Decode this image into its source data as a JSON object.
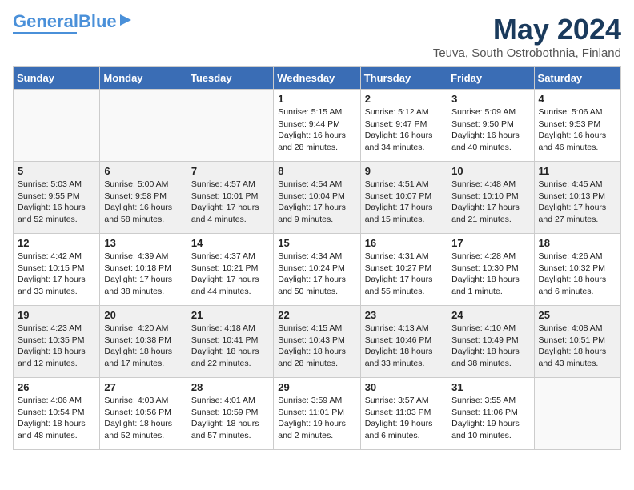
{
  "header": {
    "logo_general": "General",
    "logo_blue": "Blue",
    "month": "May 2024",
    "location": "Teuva, South Ostrobothnia, Finland"
  },
  "days_of_week": [
    "Sunday",
    "Monday",
    "Tuesday",
    "Wednesday",
    "Thursday",
    "Friday",
    "Saturday"
  ],
  "weeks": [
    [
      {
        "num": "",
        "info": ""
      },
      {
        "num": "",
        "info": ""
      },
      {
        "num": "",
        "info": ""
      },
      {
        "num": "1",
        "info": "Sunrise: 5:15 AM\nSunset: 9:44 PM\nDaylight: 16 hours\nand 28 minutes."
      },
      {
        "num": "2",
        "info": "Sunrise: 5:12 AM\nSunset: 9:47 PM\nDaylight: 16 hours\nand 34 minutes."
      },
      {
        "num": "3",
        "info": "Sunrise: 5:09 AM\nSunset: 9:50 PM\nDaylight: 16 hours\nand 40 minutes."
      },
      {
        "num": "4",
        "info": "Sunrise: 5:06 AM\nSunset: 9:53 PM\nDaylight: 16 hours\nand 46 minutes."
      }
    ],
    [
      {
        "num": "5",
        "info": "Sunrise: 5:03 AM\nSunset: 9:55 PM\nDaylight: 16 hours\nand 52 minutes."
      },
      {
        "num": "6",
        "info": "Sunrise: 5:00 AM\nSunset: 9:58 PM\nDaylight: 16 hours\nand 58 minutes."
      },
      {
        "num": "7",
        "info": "Sunrise: 4:57 AM\nSunset: 10:01 PM\nDaylight: 17 hours\nand 4 minutes."
      },
      {
        "num": "8",
        "info": "Sunrise: 4:54 AM\nSunset: 10:04 PM\nDaylight: 17 hours\nand 9 minutes."
      },
      {
        "num": "9",
        "info": "Sunrise: 4:51 AM\nSunset: 10:07 PM\nDaylight: 17 hours\nand 15 minutes."
      },
      {
        "num": "10",
        "info": "Sunrise: 4:48 AM\nSunset: 10:10 PM\nDaylight: 17 hours\nand 21 minutes."
      },
      {
        "num": "11",
        "info": "Sunrise: 4:45 AM\nSunset: 10:13 PM\nDaylight: 17 hours\nand 27 minutes."
      }
    ],
    [
      {
        "num": "12",
        "info": "Sunrise: 4:42 AM\nSunset: 10:15 PM\nDaylight: 17 hours\nand 33 minutes."
      },
      {
        "num": "13",
        "info": "Sunrise: 4:39 AM\nSunset: 10:18 PM\nDaylight: 17 hours\nand 38 minutes."
      },
      {
        "num": "14",
        "info": "Sunrise: 4:37 AM\nSunset: 10:21 PM\nDaylight: 17 hours\nand 44 minutes."
      },
      {
        "num": "15",
        "info": "Sunrise: 4:34 AM\nSunset: 10:24 PM\nDaylight: 17 hours\nand 50 minutes."
      },
      {
        "num": "16",
        "info": "Sunrise: 4:31 AM\nSunset: 10:27 PM\nDaylight: 17 hours\nand 55 minutes."
      },
      {
        "num": "17",
        "info": "Sunrise: 4:28 AM\nSunset: 10:30 PM\nDaylight: 18 hours\nand 1 minute."
      },
      {
        "num": "18",
        "info": "Sunrise: 4:26 AM\nSunset: 10:32 PM\nDaylight: 18 hours\nand 6 minutes."
      }
    ],
    [
      {
        "num": "19",
        "info": "Sunrise: 4:23 AM\nSunset: 10:35 PM\nDaylight: 18 hours\nand 12 minutes."
      },
      {
        "num": "20",
        "info": "Sunrise: 4:20 AM\nSunset: 10:38 PM\nDaylight: 18 hours\nand 17 minutes."
      },
      {
        "num": "21",
        "info": "Sunrise: 4:18 AM\nSunset: 10:41 PM\nDaylight: 18 hours\nand 22 minutes."
      },
      {
        "num": "22",
        "info": "Sunrise: 4:15 AM\nSunset: 10:43 PM\nDaylight: 18 hours\nand 28 minutes."
      },
      {
        "num": "23",
        "info": "Sunrise: 4:13 AM\nSunset: 10:46 PM\nDaylight: 18 hours\nand 33 minutes."
      },
      {
        "num": "24",
        "info": "Sunrise: 4:10 AM\nSunset: 10:49 PM\nDaylight: 18 hours\nand 38 minutes."
      },
      {
        "num": "25",
        "info": "Sunrise: 4:08 AM\nSunset: 10:51 PM\nDaylight: 18 hours\nand 43 minutes."
      }
    ],
    [
      {
        "num": "26",
        "info": "Sunrise: 4:06 AM\nSunset: 10:54 PM\nDaylight: 18 hours\nand 48 minutes."
      },
      {
        "num": "27",
        "info": "Sunrise: 4:03 AM\nSunset: 10:56 PM\nDaylight: 18 hours\nand 52 minutes."
      },
      {
        "num": "28",
        "info": "Sunrise: 4:01 AM\nSunset: 10:59 PM\nDaylight: 18 hours\nand 57 minutes."
      },
      {
        "num": "29",
        "info": "Sunrise: 3:59 AM\nSunset: 11:01 PM\nDaylight: 19 hours\nand 2 minutes."
      },
      {
        "num": "30",
        "info": "Sunrise: 3:57 AM\nSunset: 11:03 PM\nDaylight: 19 hours\nand 6 minutes."
      },
      {
        "num": "31",
        "info": "Sunrise: 3:55 AM\nSunset: 11:06 PM\nDaylight: 19 hours\nand 10 minutes."
      },
      {
        "num": "",
        "info": ""
      }
    ]
  ]
}
